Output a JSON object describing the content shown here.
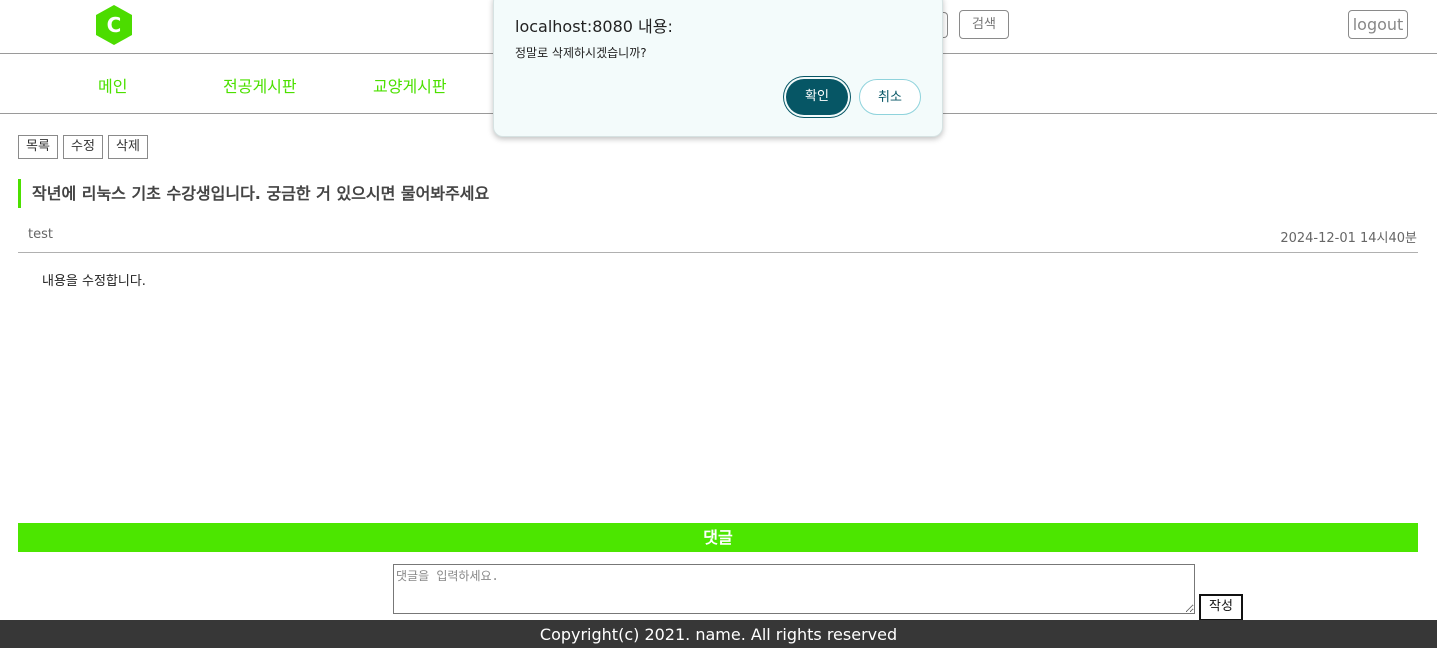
{
  "header": {
    "logo_letter": "C",
    "search_label": "검색",
    "logout_label": "logout"
  },
  "nav": {
    "items": [
      "메인",
      "전공게시판",
      "교양게시판"
    ]
  },
  "actions": {
    "list_label": "목록",
    "edit_label": "수정",
    "delete_label": "삭제"
  },
  "post": {
    "title": "작년에 리눅스 기초 수강생입니다. 궁금한 거 있으시면 물어봐주세요",
    "author": "test",
    "date": "2024-12-01 14시40분",
    "content": "내용을 수정합니다."
  },
  "comments": {
    "header": "댓글",
    "placeholder": "댓글을 입력하세요.",
    "submit_label": "작성"
  },
  "footer": {
    "text": "Copyright(c) 2021. name. All rights reserved"
  },
  "dialog": {
    "title": "localhost:8080 내용:",
    "message": "정말로 삭제하시겠습니까?",
    "ok_label": "확인",
    "cancel_label": "취소"
  },
  "colors": {
    "accent_green": "#4ce600",
    "dialog_primary": "#065665",
    "footer_bg": "#373737"
  }
}
